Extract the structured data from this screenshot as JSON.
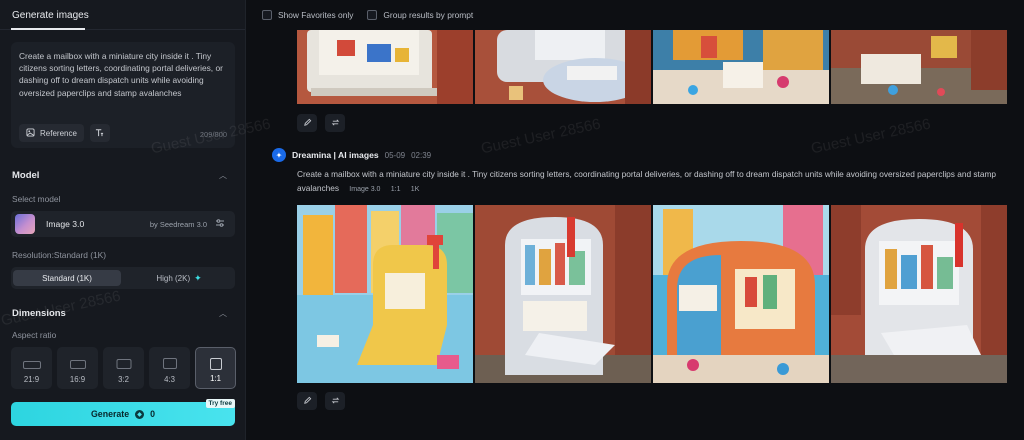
{
  "left_panel": {
    "tab_label": "Generate images",
    "prompt_text": "Create a mailbox with a miniature city inside it . Tiny citizens sorting letters, coordinating portal deliveries, or dashing off to dream dispatch units while avoiding oversized paperclips and stamp avalanches",
    "reference_label": "Reference",
    "char_counter": "209/800",
    "model_section": {
      "title": "Model",
      "select_label": "Select model",
      "model_name": "Image 3.0",
      "model_by": "by Seedream 3.0"
    },
    "resolution": {
      "label": "Resolution:Standard (1K)",
      "options": [
        "Standard (1K)",
        "High (2K)"
      ]
    },
    "dimensions": {
      "title": "Dimensions",
      "aspect_label": "Aspect ratio",
      "ratios": [
        "21:9",
        "16:9",
        "3:2",
        "4:3",
        "1:1"
      ],
      "selected": "1:1"
    },
    "generate": {
      "label": "Generate",
      "credits": "0",
      "badge": "Try free"
    }
  },
  "filters": {
    "favorites": "Show Favorites only",
    "group": "Group results by prompt"
  },
  "generation": {
    "source": "Dreamina | AI images",
    "date": "05-09",
    "time": "02:39",
    "prompt": "Create a mailbox with a miniature city inside it . Tiny citizens sorting letters, coordinating portal deliveries, or dashing off to dream dispatch units while avoiding oversized paperclips and stamp avalanches",
    "tags": [
      "Image 3.0",
      "1:1",
      "1K"
    ]
  },
  "watermark": "Guest User 28566",
  "icons": {
    "reference": "image-icon",
    "text_format": "text-format-icon",
    "settings": "sliders-icon",
    "edit": "pencil-icon",
    "regenerate": "refresh-icon",
    "collapse": "chevron-up-icon",
    "sparkle": "sparkle-icon",
    "credit": "coin-icon"
  },
  "colors": {
    "accent": "#2dd5e0",
    "brand_avatar": "#1a6ae8",
    "panel_bg": "#16191f"
  }
}
